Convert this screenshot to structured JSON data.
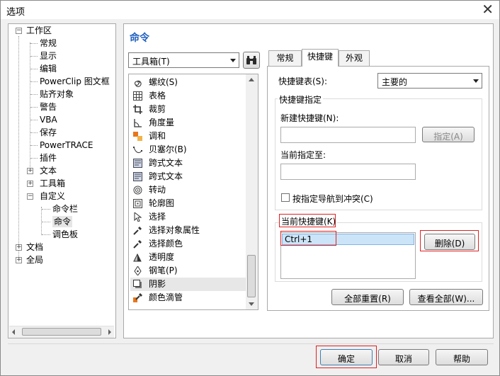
{
  "window": {
    "title": "选项",
    "close": "✕"
  },
  "tree": {
    "items": [
      {
        "label": "工作区",
        "expander": "−"
      },
      {
        "label": "常规"
      },
      {
        "label": "显示"
      },
      {
        "label": "编辑"
      },
      {
        "label": "PowerClip 图文框"
      },
      {
        "label": "贴齐对象"
      },
      {
        "label": "警告"
      },
      {
        "label": "VBA"
      },
      {
        "label": "保存"
      },
      {
        "label": "PowerTRACE"
      },
      {
        "label": "插件"
      },
      {
        "label": "文本",
        "expander": "+"
      },
      {
        "label": "工具箱",
        "expander": "+"
      },
      {
        "label": "自定义",
        "expander": "−"
      },
      {
        "label": "命令栏"
      },
      {
        "label": "命令",
        "selected": true
      },
      {
        "label": "调色板"
      },
      {
        "label": "文档",
        "expander": "+"
      },
      {
        "label": "全局",
        "expander": "+"
      }
    ]
  },
  "main": {
    "section_title": "命令",
    "category_combo": "工具箱(T)",
    "commands": [
      {
        "label": "螺纹(S)",
        "icon": "spiral-icon"
      },
      {
        "label": "表格",
        "icon": "table-icon"
      },
      {
        "label": "裁剪",
        "icon": "crop-icon"
      },
      {
        "label": "角度量",
        "icon": "angle-icon"
      },
      {
        "label": "调和",
        "icon": "blend-icon"
      },
      {
        "label": "贝塞尔(B)",
        "icon": "bezier-icon"
      },
      {
        "label": "跨式文本",
        "icon": "text-frame-icon"
      },
      {
        "label": "跨式文本",
        "icon": "text-frame-icon"
      },
      {
        "label": "转动",
        "icon": "twirl-icon"
      },
      {
        "label": "轮廓图",
        "icon": "contour-icon"
      },
      {
        "label": "选择",
        "icon": "pointer-icon"
      },
      {
        "label": "选择对象属性",
        "icon": "eyedropper-icon"
      },
      {
        "label": "选择颜色",
        "icon": "eyedropper-icon"
      },
      {
        "label": "透明度",
        "icon": "transparency-icon"
      },
      {
        "label": "钢笔(P)",
        "icon": "pen-icon"
      },
      {
        "label": "阴影",
        "icon": "shadow-icon",
        "selected": true
      },
      {
        "label": "颜色滴管",
        "icon": "color-eyedropper-icon"
      }
    ]
  },
  "tabs": [
    {
      "label": "常规"
    },
    {
      "label": "快捷键",
      "active": true
    },
    {
      "label": "外观"
    }
  ],
  "shortcuts": {
    "table_label": "快捷键表(S):",
    "table_value": "主要的",
    "assign_group": "快捷键指定",
    "new_label": "新建快捷键(N):",
    "new_value": "",
    "assign_button": "指定(A)",
    "current_assigned_label": "当前指定至:",
    "current_assigned_value": "",
    "nav_conflict_label": "按指定导航到冲突(C)",
    "current_shortcuts_label": "当前快捷键(K)",
    "current_shortcuts": [
      "Ctrl+1"
    ],
    "delete_button": "删除(D)",
    "reset_all_button": "全部重置(R)",
    "view_all_button": "查看全部(W)..."
  },
  "footer": {
    "ok": "确定",
    "cancel": "取消",
    "help": "帮助"
  }
}
